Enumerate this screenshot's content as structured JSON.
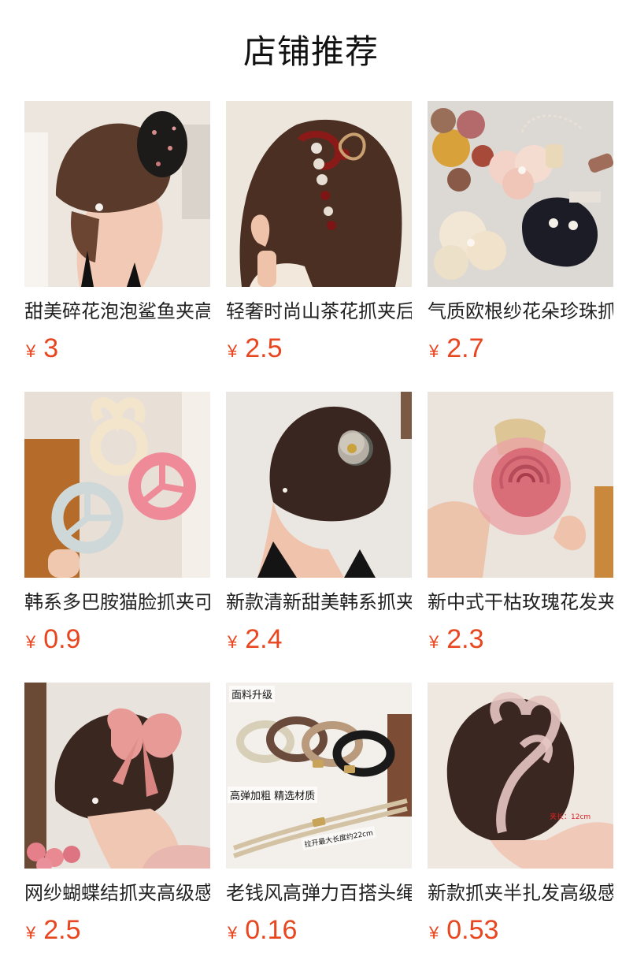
{
  "page": {
    "title": "店铺推荐"
  },
  "colors": {
    "price": "#e8461f",
    "title": "#111111",
    "text": "#222222",
    "background": "#ffffff"
  },
  "products": [
    {
      "name": "甜美碎花泡泡鲨鱼夹高级感",
      "currency": "¥",
      "price": "3",
      "image_icon": "hair-claw-scrunchie-photo"
    },
    {
      "name": "轻奢时尚山茶花抓夹后脑勺",
      "currency": "¥",
      "price": "2.5",
      "image_icon": "camellia-claw-clip-photo"
    },
    {
      "name": "气质欧根纱花朵珍珠抓夹",
      "currency": "¥",
      "price": "2.7",
      "image_icon": "organza-flower-clips-photo"
    },
    {
      "name": "韩系多巴胺猫脸抓夹可爱",
      "currency": "¥",
      "price": "0.9",
      "image_icon": "flower-shaped-claws-photo"
    },
    {
      "name": "新款清新甜美韩系抓夹",
      "currency": "¥",
      "price": "2.4",
      "image_icon": "flower-claw-clip-photo"
    },
    {
      "name": "新中式干枯玫瑰花发夹",
      "currency": "¥",
      "price": "2.3",
      "image_icon": "rose-hair-clip-photo"
    },
    {
      "name": "网纱蝴蝶结抓夹高级感",
      "currency": "¥",
      "price": "2.5",
      "image_icon": "bow-claw-clip-photo"
    },
    {
      "name": "老钱风高弹力百搭头绳",
      "currency": "¥",
      "price": "0.16",
      "image_icon": "hair-ties-photo",
      "overlay": {
        "top_label": "面料升级",
        "mid_label": "高弹加粗 精选材质",
        "measure_label": "拉开最大长度约22cm"
      }
    },
    {
      "name": "新款抓夹半扎发高级感",
      "currency": "¥",
      "price": "0.53",
      "image_icon": "heart-claw-clip-photo",
      "overlay": {
        "size_label": "夹长：12cm"
      }
    }
  ]
}
